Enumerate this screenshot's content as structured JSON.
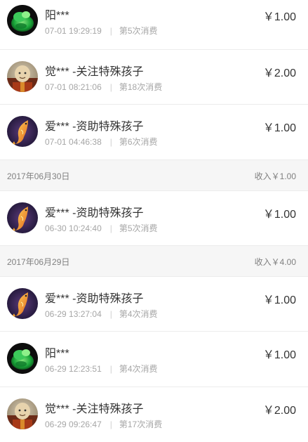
{
  "entries_group1": [
    {
      "name": "阳***",
      "time": "07-01 19:29:19",
      "count": "第5次消费",
      "amount": "￥1.00",
      "avatar": "green-avatar"
    },
    {
      "name": "觉*** -关注特殊孩子",
      "time": "07-01 08:21:06",
      "count": "第18次消费",
      "amount": "￥2.00",
      "avatar": "monk-avatar"
    },
    {
      "name": "爱*** -资助特殊孩子",
      "time": "07-01 04:46:38",
      "count": "第6次消费",
      "amount": "￥1.00",
      "avatar": "koi-avatar"
    }
  ],
  "date_group2": {
    "date": "2017年06月30日",
    "income": "收入￥1.00"
  },
  "entries_group2": [
    {
      "name": "爱*** -资助特殊孩子",
      "time": "06-30 10:24:40",
      "count": "第5次消费",
      "amount": "￥1.00",
      "avatar": "koi-avatar"
    }
  ],
  "date_group3": {
    "date": "2017年06月29日",
    "income": "收入￥4.00"
  },
  "entries_group3": [
    {
      "name": "爱*** -资助特殊孩子",
      "time": "06-29 13:27:04",
      "count": "第4次消费",
      "amount": "￥1.00",
      "avatar": "koi-avatar"
    },
    {
      "name": "阳***",
      "time": "06-29 12:23:51",
      "count": "第4次消费",
      "amount": "￥1.00",
      "avatar": "green-avatar"
    },
    {
      "name": "觉*** -关注特殊孩子",
      "time": "06-29 09:26:47",
      "count": "第17次消费",
      "amount": "￥2.00",
      "avatar": "monk-avatar"
    }
  ],
  "separator": "|",
  "colors": {
    "header_bg": "#f6f6f6",
    "meta_text": "#a6a6a6",
    "main_text": "#333333"
  }
}
